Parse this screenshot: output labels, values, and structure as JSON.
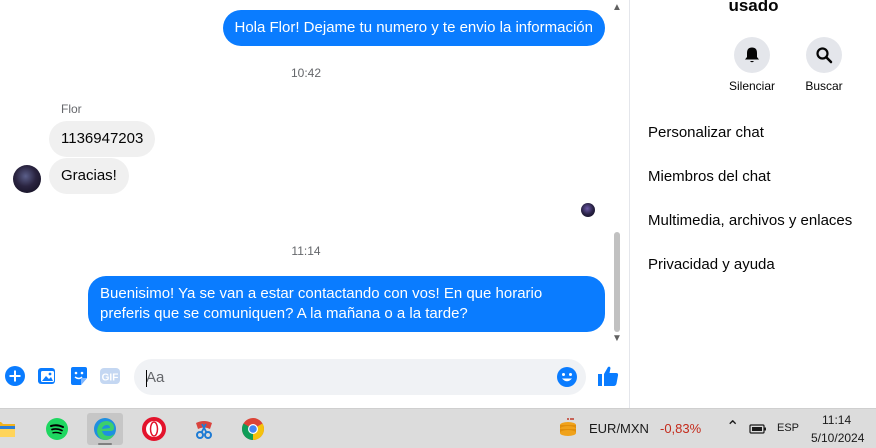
{
  "chat": {
    "messages": [
      {
        "text": "Hola Flor! Dejame tu numero y te envio la información"
      },
      {
        "text": "1136947203"
      },
      {
        "text": "Gracias!"
      },
      {
        "text": "Buenisimo! Ya se van a estar contactando con vos! En que horario preferis que se comuniquen? A la mañana o a la tarde?"
      }
    ],
    "timestamps": [
      "10:42",
      "11:14"
    ],
    "sender_name": "Flor"
  },
  "composer": {
    "placeholder": "Aa",
    "accent_color": "#0a7cff"
  },
  "info_panel": {
    "title_fragment": "usado",
    "actions": [
      {
        "label": "Silenciar",
        "icon": "bell-icon"
      },
      {
        "label": "Buscar",
        "icon": "search-icon"
      }
    ],
    "items": [
      "Personalizar chat",
      "Miembros del chat",
      "Multimedia, archivos y enlaces",
      "Privacidad y ayuda"
    ]
  },
  "taskbar": {
    "apps": [
      "file-explorer-icon",
      "spotify-icon",
      "edge-icon",
      "opera-icon",
      "snipping-tool-icon",
      "chrome-icon"
    ],
    "currency_pair": "EUR/MXN",
    "currency_change": "-0,83%",
    "language": "ESP",
    "time": "11:14",
    "date": "5/10/2024"
  }
}
